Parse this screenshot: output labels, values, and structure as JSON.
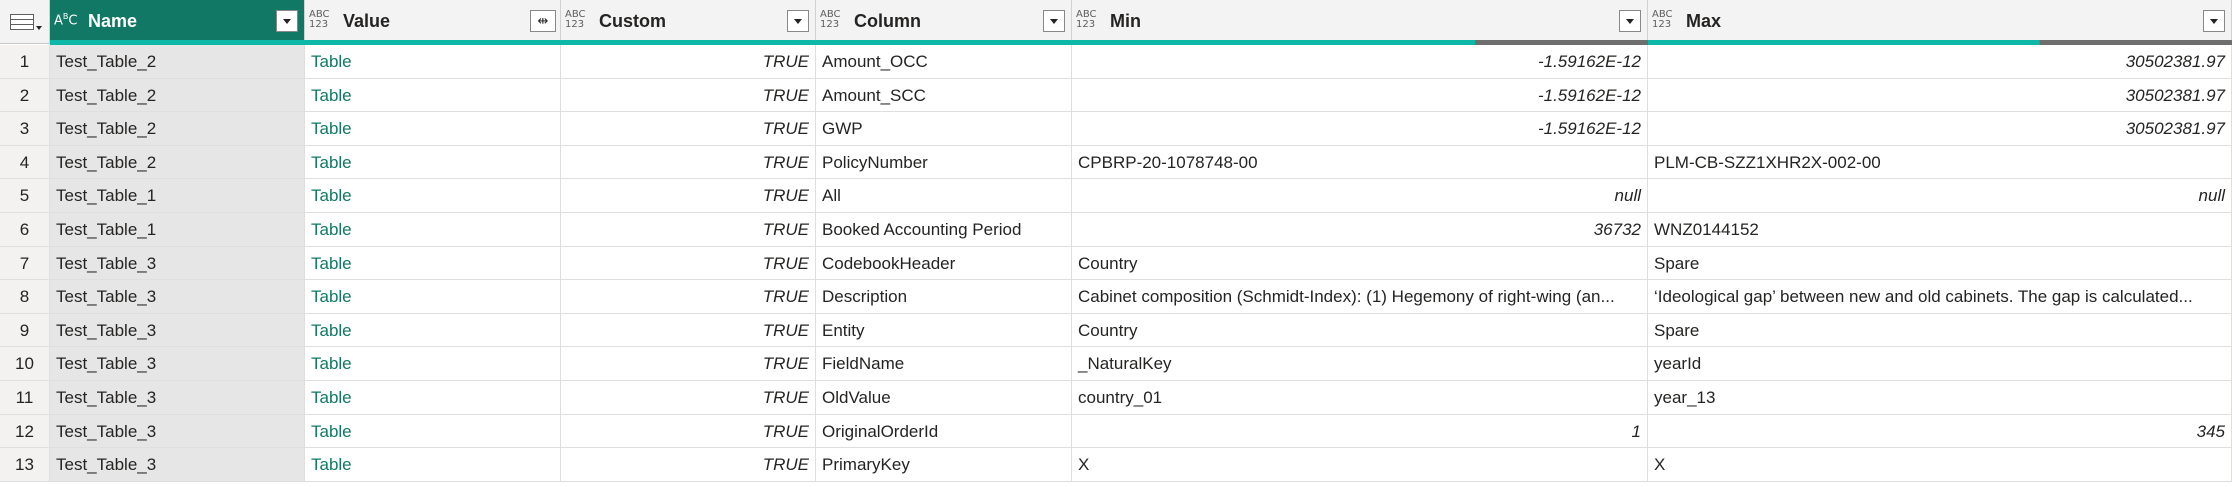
{
  "columns": [
    {
      "name": "Name",
      "type_icon": "ABC"
    },
    {
      "name": "Value",
      "type_icon": "ABC/123"
    },
    {
      "name": "Custom",
      "type_icon": "ABC/123"
    },
    {
      "name": "Column",
      "type_icon": "ABC/123"
    },
    {
      "name": "Min",
      "type_icon": "ABC/123"
    },
    {
      "name": "Max",
      "type_icon": "ABC/123"
    }
  ],
  "rows": [
    {
      "n": "1",
      "name": "Test_Table_2",
      "value": "Table",
      "custom": "TRUE",
      "column": "Amount_OCC",
      "min": "-1.59162E-12",
      "max": "30502381.97"
    },
    {
      "n": "2",
      "name": "Test_Table_2",
      "value": "Table",
      "custom": "TRUE",
      "column": "Amount_SCC",
      "min": "-1.59162E-12",
      "max": "30502381.97"
    },
    {
      "n": "3",
      "name": "Test_Table_2",
      "value": "Table",
      "custom": "TRUE",
      "column": "GWP",
      "min": "-1.59162E-12",
      "max": "30502381.97"
    },
    {
      "n": "4",
      "name": "Test_Table_2",
      "value": "Table",
      "custom": "TRUE",
      "column": "PolicyNumber",
      "min": "CPBRP-20-1078748-00",
      "max": "PLM-CB-SZZ1XHR2X-002-00"
    },
    {
      "n": "5",
      "name": "Test_Table_1",
      "value": "Table",
      "custom": "TRUE",
      "column": "All",
      "min": "null",
      "max": "null"
    },
    {
      "n": "6",
      "name": "Test_Table_1",
      "value": "Table",
      "custom": "TRUE",
      "column": "Booked Accounting Period",
      "min": "36732",
      "max": "WNZ0144152"
    },
    {
      "n": "7",
      "name": "Test_Table_3",
      "value": "Table",
      "custom": "TRUE",
      "column": "CodebookHeader",
      "min": "Country",
      "max": "Spare"
    },
    {
      "n": "8",
      "name": "Test_Table_3",
      "value": "Table",
      "custom": "TRUE",
      "column": "Description",
      "min": "Cabinet composition (Schmidt-Index): (1) Hegemony of right-wing (an...",
      "max": "‘Ideological gap’ between new and old cabinets. The gap is calculated..."
    },
    {
      "n": "9",
      "name": "Test_Table_3",
      "value": "Table",
      "custom": "TRUE",
      "column": "Entity",
      "min": "Country",
      "max": "Spare"
    },
    {
      "n": "10",
      "name": "Test_Table_3",
      "value": "Table",
      "custom": "TRUE",
      "column": "FieldName",
      "min": "_NaturalKey",
      "max": "yearId"
    },
    {
      "n": "11",
      "name": "Test_Table_3",
      "value": "Table",
      "custom": "TRUE",
      "column": "OldValue",
      "min": "country_01",
      "max": "year_13"
    },
    {
      "n": "12",
      "name": "Test_Table_3",
      "value": "Table",
      "custom": "TRUE",
      "column": "OriginalOrderId",
      "min": "1",
      "max": "345"
    },
    {
      "n": "13",
      "name": "Test_Table_3",
      "value": "Table",
      "custom": "TRUE",
      "column": "PrimaryKey",
      "min": "X",
      "max": "X"
    }
  ],
  "column_quality_valid_fraction": {
    "min": 0.7,
    "max": 0.67
  },
  "colors": {
    "accent": "#117865",
    "quality_valid": "#0db9a6",
    "quality_empty": "#6e6e6e"
  }
}
